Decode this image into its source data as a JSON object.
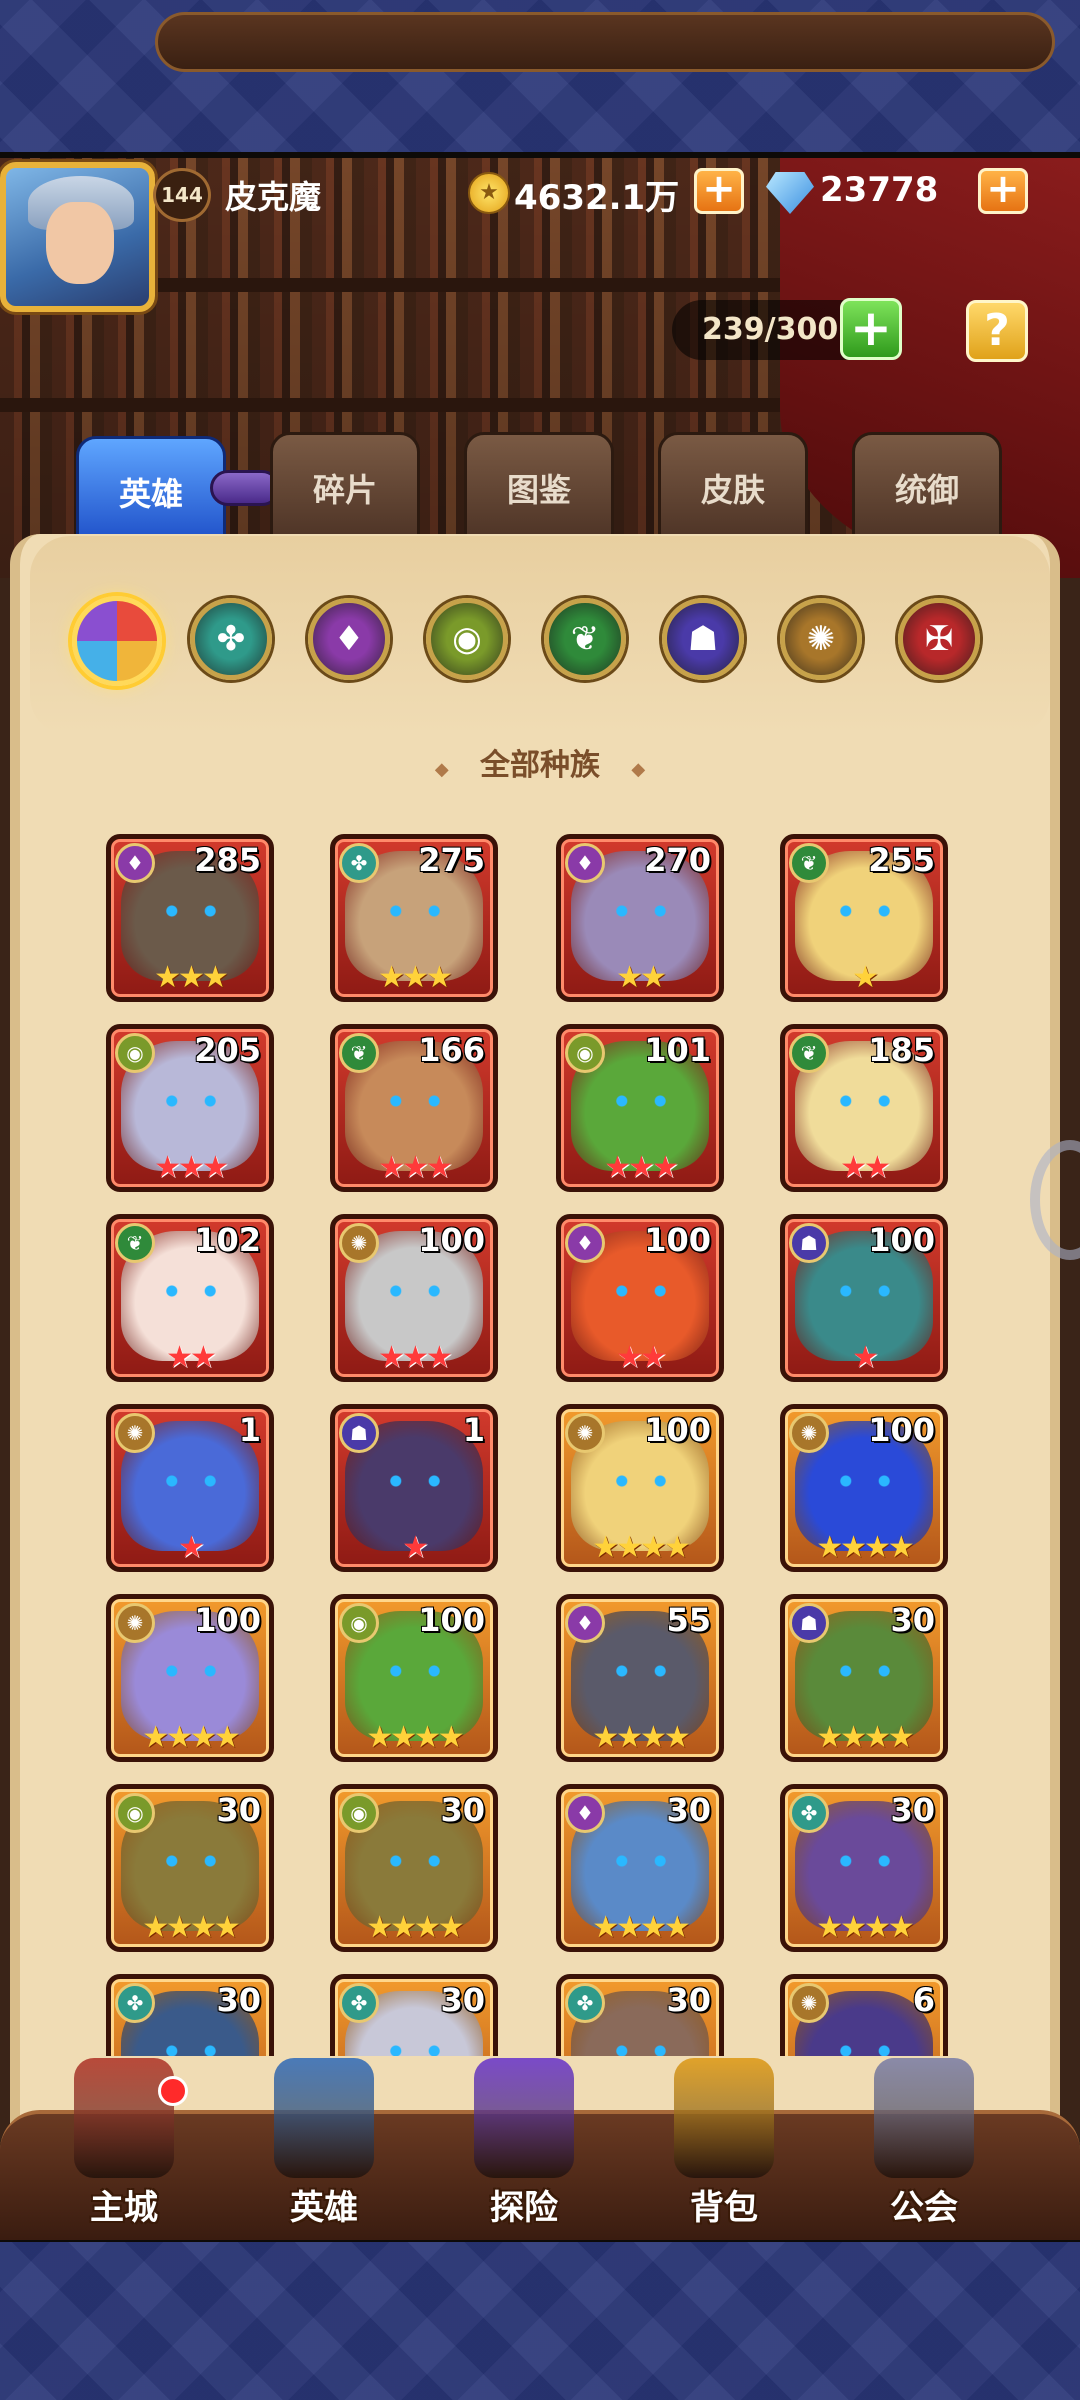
{
  "header": {
    "player_level": "144",
    "player_name": "皮克魔",
    "gold": "4632.1万",
    "gems": "23778",
    "capacity": "239/300",
    "help_label": "?",
    "plus_label": "+"
  },
  "tabs": [
    {
      "label": "英雄",
      "active": true
    },
    {
      "label": "碎片"
    },
    {
      "label": "图鉴"
    },
    {
      "label": "皮肤"
    },
    {
      "label": "统御"
    }
  ],
  "factions": [
    {
      "name": "all-factions-icon",
      "color": "#e84b3c"
    },
    {
      "name": "forest-faction-icon",
      "color": "#2f9a8a"
    },
    {
      "name": "shadow-faction-icon",
      "color": "#8a3aa8"
    },
    {
      "name": "fortress-faction-icon",
      "color": "#7a9a2a"
    },
    {
      "name": "nature-faction-icon",
      "color": "#2f8a3a"
    },
    {
      "name": "abyss-faction-icon",
      "color": "#4a3aa8"
    },
    {
      "name": "light-faction-icon",
      "color": "#a8762a"
    },
    {
      "name": "dark-faction-icon",
      "color": "#b8282a"
    }
  ],
  "section_title": "全部种族",
  "heroes": [
    {
      "level": "285",
      "frame": "red",
      "stars": "★★★",
      "star_type": "gold",
      "faction": "shadow",
      "portrait": "#6b5a4a"
    },
    {
      "level": "275",
      "frame": "red",
      "stars": "★★★",
      "star_type": "gold",
      "faction": "forest",
      "portrait": "#c7a27a"
    },
    {
      "level": "270",
      "frame": "red",
      "stars": "★★",
      "star_type": "gold",
      "faction": "shadow",
      "portrait": "#9a8ab8"
    },
    {
      "level": "255",
      "frame": "red",
      "stars": "★",
      "star_type": "gold",
      "faction": "nature",
      "portrait": "#f0d27a"
    },
    {
      "level": "205",
      "frame": "red",
      "stars": "★★★",
      "star_type": "redstar",
      "faction": "fortress",
      "portrait": "#b8b8d8"
    },
    {
      "level": "166",
      "frame": "red",
      "stars": "★★★",
      "star_type": "redstar",
      "faction": "nature",
      "portrait": "#c78a5a"
    },
    {
      "level": "101",
      "frame": "red",
      "stars": "★★★",
      "star_type": "redstar",
      "faction": "fortress",
      "portrait": "#5aa83a"
    },
    {
      "level": "185",
      "frame": "red",
      "stars": "★★",
      "star_type": "redstar",
      "faction": "nature",
      "portrait": "#f0dc9a"
    },
    {
      "level": "102",
      "frame": "red",
      "stars": "★★",
      "star_type": "redstar",
      "faction": "nature",
      "portrait": "#f5e0d8"
    },
    {
      "level": "100",
      "frame": "red",
      "stars": "★★★",
      "star_type": "redstar",
      "faction": "light",
      "portrait": "#c8c8c8"
    },
    {
      "level": "100",
      "frame": "red",
      "stars": "★★",
      "star_type": "redstar",
      "faction": "shadow",
      "portrait": "#e85a2a"
    },
    {
      "level": "100",
      "frame": "red",
      "stars": "★",
      "star_type": "redstar",
      "faction": "abyss",
      "portrait": "#3a8a8a"
    },
    {
      "level": "1",
      "frame": "red",
      "stars": "★",
      "star_type": "redstar",
      "faction": "light",
      "portrait": "#4a6ad8"
    },
    {
      "level": "1",
      "frame": "red",
      "stars": "★",
      "star_type": "redstar",
      "faction": "abyss",
      "portrait": "#4a3a6a"
    },
    {
      "level": "100",
      "frame": "orange",
      "stars": "★★★★",
      "star_type": "gold",
      "faction": "light",
      "portrait": "#f0d27a"
    },
    {
      "level": "100",
      "frame": "orange",
      "stars": "★★★★",
      "star_type": "gold",
      "faction": "light",
      "portrait": "#2a4ad8"
    },
    {
      "level": "100",
      "frame": "orange",
      "stars": "★★★★",
      "star_type": "gold",
      "faction": "light",
      "portrait": "#9a8ad8"
    },
    {
      "level": "100",
      "frame": "orange",
      "stars": "★★★★",
      "star_type": "gold",
      "faction": "fortress",
      "portrait": "#5aa83a"
    },
    {
      "level": "55",
      "frame": "orange",
      "stars": "★★★★",
      "star_type": "gold",
      "faction": "shadow",
      "portrait": "#5a5a6a"
    },
    {
      "level": "30",
      "frame": "orange",
      "stars": "★★★★",
      "star_type": "gold",
      "faction": "abyss",
      "portrait": "#5a8a3a"
    },
    {
      "level": "30",
      "frame": "orange",
      "stars": "★★★★",
      "star_type": "gold",
      "faction": "fortress",
      "portrait": "#8a7a3a"
    },
    {
      "level": "30",
      "frame": "orange",
      "stars": "★★★★",
      "star_type": "gold",
      "faction": "fortress",
      "portrait": "#8a7a3a"
    },
    {
      "level": "30",
      "frame": "orange",
      "stars": "★★★★",
      "star_type": "gold",
      "faction": "shadow",
      "portrait": "#5a8ac8"
    },
    {
      "level": "30",
      "frame": "orange",
      "stars": "★★★★",
      "star_type": "gold",
      "faction": "forest",
      "portrait": "#6a4a9a"
    },
    {
      "level": "30",
      "frame": "orange",
      "stars": "",
      "star_type": "gold",
      "faction": "forest",
      "portrait": "#3a5a8a"
    },
    {
      "level": "30",
      "frame": "orange",
      "stars": "",
      "star_type": "gold",
      "faction": "forest",
      "portrait": "#c8c8d8"
    },
    {
      "level": "30",
      "frame": "orange",
      "stars": "",
      "star_type": "gold",
      "faction": "forest",
      "portrait": "#8a6a5a"
    },
    {
      "level": "6",
      "frame": "orange",
      "stars": "",
      "star_type": "gold",
      "faction": "light",
      "portrait": "#4a3a8a"
    }
  ],
  "bottom_nav": [
    {
      "label": "主城",
      "name": "nav-main-city",
      "color": "#b84a3a"
    },
    {
      "label": "英雄",
      "name": "nav-heroes",
      "color": "#4a7ab8"
    },
    {
      "label": "探险",
      "name": "nav-adventure",
      "color": "#7a4ac8"
    },
    {
      "label": "背包",
      "name": "nav-backpack",
      "color": "#e0a22a"
    },
    {
      "label": "公会",
      "name": "nav-guild",
      "color": "#8a8aa8"
    }
  ]
}
